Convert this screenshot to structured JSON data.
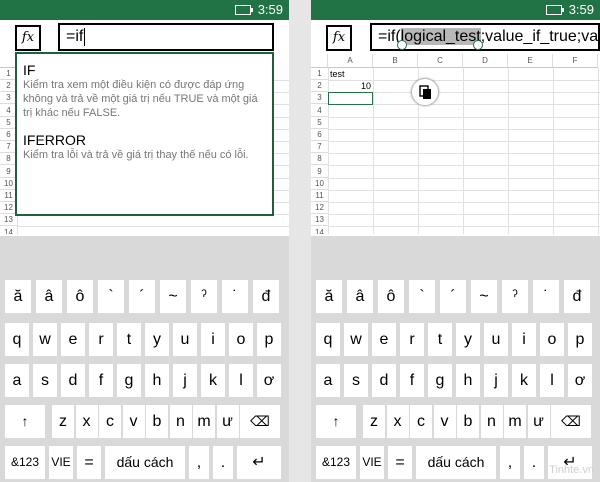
{
  "status": {
    "time": "3:59"
  },
  "fx_label": "fx",
  "left": {
    "formula": "=if",
    "suggestions": [
      {
        "name": "IF",
        "desc": "Kiểm tra xem một điều kiện có được đáp ứng không và trả về một giá trị nếu TRUE và một giá trị khác nếu FALSE."
      },
      {
        "name": "IFERROR",
        "desc": "Kiểm tra lỗi và trả về giá trị thay thế nếu có lỗi."
      }
    ],
    "rows": [
      "1",
      "2",
      "3",
      "4",
      "5",
      "6",
      "7",
      "8",
      "9",
      "10",
      "11",
      "12",
      "13",
      "14"
    ]
  },
  "right": {
    "formula_prefix": "=if(",
    "formula_selected": "logical_test",
    "formula_suffix": ";value_if_true;valu",
    "columns": [
      "A",
      "B",
      "C",
      "D",
      "E",
      "F"
    ],
    "rows": [
      "1",
      "2",
      "3",
      "4",
      "5",
      "6",
      "7",
      "8",
      "9",
      "10",
      "11",
      "12",
      "13",
      "14"
    ],
    "cells": {
      "A1": "test",
      "A2": "10"
    }
  },
  "keyboard": {
    "row1": [
      "ă",
      "â",
      "ô",
      "`",
      "´",
      "~",
      "ˀ",
      "˙",
      "đ"
    ],
    "row2": [
      "q",
      "w",
      "e",
      "r",
      "t",
      "y",
      "u",
      "i",
      "o",
      "p"
    ],
    "row3": [
      "a",
      "s",
      "d",
      "f",
      "g",
      "h",
      "j",
      "k",
      "l",
      "ơ"
    ],
    "row4": [
      "↑",
      "z",
      "x",
      "c",
      "v",
      "b",
      "n",
      "m",
      "ư",
      "⌫"
    ],
    "row5": {
      "num": "&123",
      "lang": "VIE",
      "eq": "=",
      "space": "dấu cách",
      "comma": ",",
      "dot": ".",
      "enter": "↵"
    }
  },
  "watermark": "Tinhte.vn"
}
